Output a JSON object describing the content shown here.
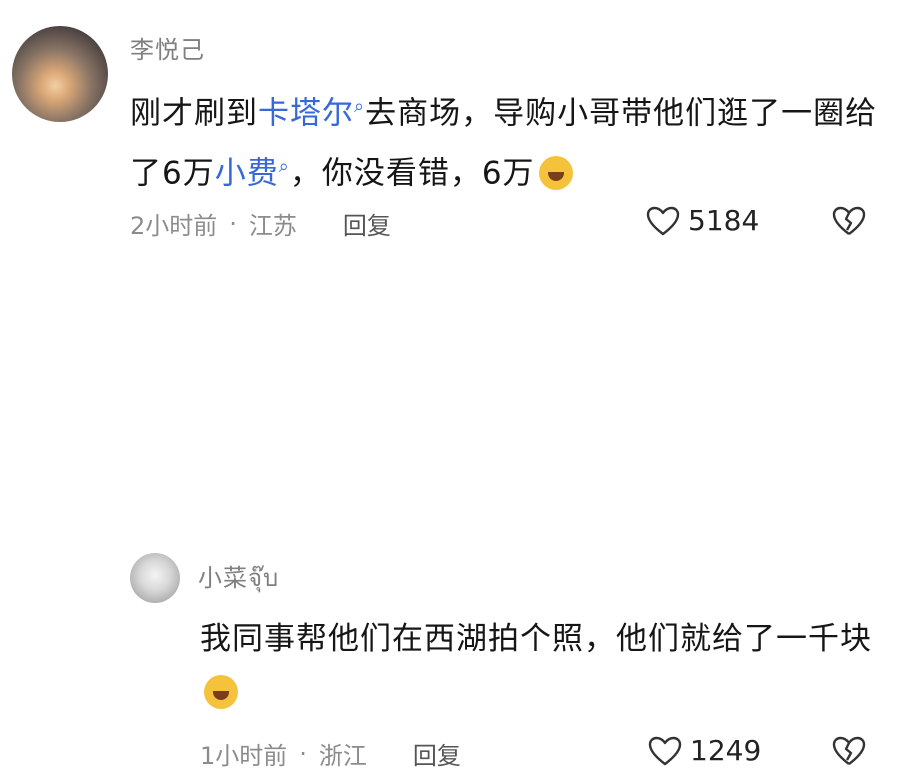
{
  "comments": [
    {
      "username": "李悦己",
      "text_parts": [
        {
          "text": "刚才刷到",
          "link": false
        },
        {
          "text": "卡塔尔",
          "link": true
        },
        {
          "text": "去商场，导购小哥带他们逛了一圈给了6万",
          "link": false
        },
        {
          "text": "小费",
          "link": true
        },
        {
          "text": "，你没看错，6万",
          "link": false
        }
      ],
      "time": "2小时前",
      "location": "江苏",
      "reply_label": "回复",
      "likes": "5184"
    },
    {
      "username": "小菜จุ๊บ",
      "text": "我同事帮他们在西湖拍个照，他们就给了一千块",
      "time": "1小时前",
      "location": "浙江",
      "reply_label": "回复",
      "likes": "1249"
    }
  ],
  "icons": {
    "search_suffix": "search-icon",
    "like": "heart-outline-icon",
    "dislike": "broken-heart-icon",
    "emoji1": "laughing-tears-emoji",
    "emoji2": "pleading-tears-emoji"
  },
  "colors": {
    "link": "#3569d8",
    "meta": "#8c8c8c",
    "text": "#161616"
  }
}
